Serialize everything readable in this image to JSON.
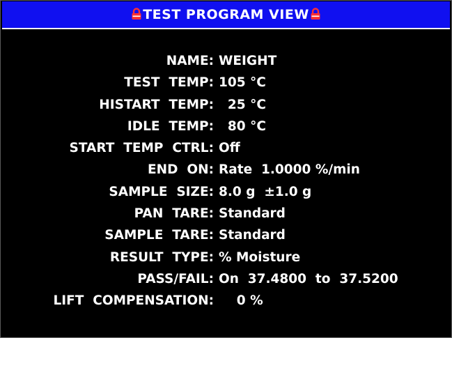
{
  "header": {
    "title": "TEST PROGRAM VIEW",
    "left_icon": "lock-icon",
    "right_icon": "lock-icon",
    "background_color": "#1010f0",
    "lock_color": "#ff3030"
  },
  "program": {
    "rows": [
      {
        "label": "NAME:",
        "value": "WEIGHT"
      },
      {
        "label": "TEST  TEMP:",
        "value": "105 °C"
      },
      {
        "label": "HISTART  TEMP:",
        "value": "  25 °C"
      },
      {
        "label": "IDLE  TEMP:",
        "value": "  80 °C"
      },
      {
        "label": "START  TEMP  CTRL:",
        "value": "Off"
      },
      {
        "label": "END  ON:",
        "value": "Rate  1.0000 %/min"
      },
      {
        "label": "SAMPLE  SIZE:",
        "value": "8.0 g  ±1.0 g"
      },
      {
        "label": "PAN  TARE:",
        "value": "Standard"
      },
      {
        "label": "SAMPLE  TARE:",
        "value": "Standard"
      },
      {
        "label": "RESULT  TYPE:",
        "value": "% Moisture"
      },
      {
        "label": "PASS/FAIL:",
        "value": "On  37.4800  to  37.5200"
      },
      {
        "label": "LIFT  COMPENSATION:",
        "value": "    0 %"
      }
    ]
  }
}
